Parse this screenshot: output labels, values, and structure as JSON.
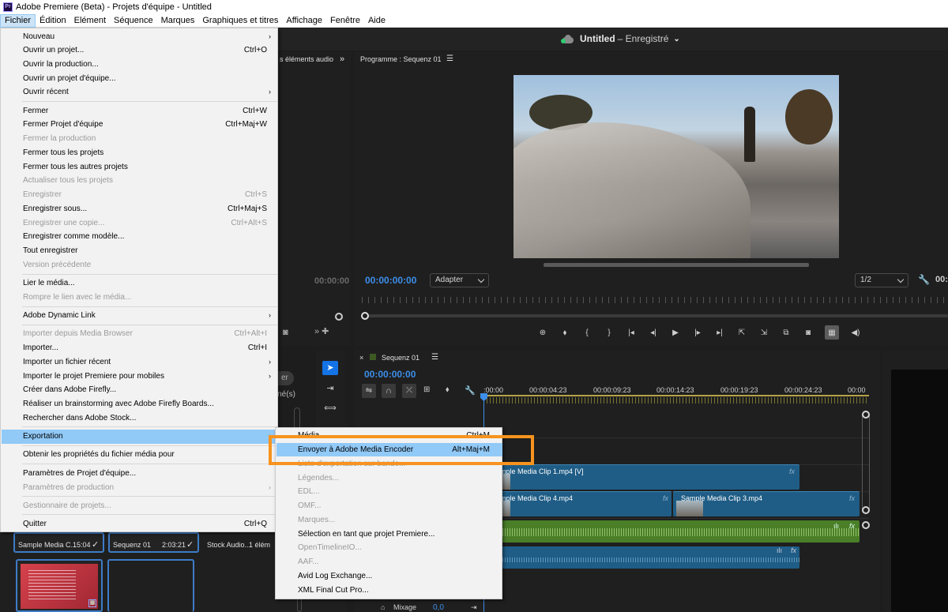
{
  "window": {
    "app_logo_text": "Pr",
    "title": "Adobe Premiere (Beta) - Projets d'équipe - Untitled"
  },
  "menubar": [
    "Fichier",
    "Édition",
    "Elément",
    "Séquence",
    "Marques",
    "Graphiques et titres",
    "Affichage",
    "Fenêtre",
    "Aide"
  ],
  "header": {
    "project_name": "Untitled",
    "status": "– Enregistré"
  },
  "program_monitor": {
    "title": "Programme : Sequenz 01",
    "timecode": "00:00:00:00",
    "fit": "Adapter",
    "resolution": "1/2",
    "right_timecode": "00:"
  },
  "left_panel": {
    "tab": "s éléments audio",
    "timecode": "00:00:00",
    "partial_button": "er",
    "partial_label": "onné(s)"
  },
  "timeline": {
    "title": "Sequenz 01",
    "timecode": "00:00:00:00",
    "ruler_labels": [
      ":00:00",
      "00:00:04:23",
      "00:00:09:23",
      "00:00:14:23",
      "00:00:19:23",
      "00:00:24:23",
      "00:00"
    ],
    "clips": {
      "v2": "Sample Media Clip 1.mp4 [V]",
      "v1a": "Sample Media Clip 4.mp4",
      "v1b": "Sample Media Clip 3.mp4"
    },
    "mixage_label": "Mixage",
    "mixage_value": "0,0"
  },
  "project_panel": {
    "items": [
      {
        "name": "Sample Media C...",
        "duration": "15:04"
      },
      {
        "name": "Sequenz 01",
        "duration": "2:03:21"
      },
      {
        "name": "Stock Audio...",
        "duration": "1 élém"
      }
    ]
  },
  "file_menu": [
    {
      "label": "Nouveau",
      "shortcut": "",
      "submenu": true,
      "enabled": true
    },
    {
      "label": "Ouvrir un projet...",
      "shortcut": "Ctrl+O",
      "enabled": true
    },
    {
      "label": "Ouvrir la production...",
      "shortcut": "",
      "enabled": true
    },
    {
      "label": "Ouvrir un projet d'équipe...",
      "shortcut": "",
      "enabled": true
    },
    {
      "label": "Ouvrir récent",
      "shortcut": "",
      "submenu": true,
      "enabled": true
    },
    {
      "label": "Fermer",
      "shortcut": "Ctrl+W",
      "enabled": true
    },
    {
      "label": "Fermer Projet d'équipe",
      "shortcut": "Ctrl+Maj+W",
      "enabled": true
    },
    {
      "label": "Fermer la production",
      "shortcut": "",
      "enabled": false
    },
    {
      "label": "Fermer tous les projets",
      "shortcut": "",
      "enabled": true
    },
    {
      "label": "Fermer tous les autres projets",
      "shortcut": "",
      "enabled": true
    },
    {
      "label": "Actualiser tous les projets",
      "shortcut": "",
      "enabled": false
    },
    {
      "label": "Enregistrer",
      "shortcut": "Ctrl+S",
      "enabled": false
    },
    {
      "label": "Enregistrer sous...",
      "shortcut": "Ctrl+Maj+S",
      "enabled": true
    },
    {
      "label": "Enregistrer une copie...",
      "shortcut": "Ctrl+Alt+S",
      "enabled": false
    },
    {
      "label": "Enregistrer comme modèle...",
      "shortcut": "",
      "enabled": true
    },
    {
      "label": "Tout enregistrer",
      "shortcut": "",
      "enabled": true
    },
    {
      "label": "Version précédente",
      "shortcut": "",
      "enabled": false
    },
    {
      "label": "Lier le média...",
      "shortcut": "",
      "enabled": true
    },
    {
      "label": "Rompre le lien avec le média...",
      "shortcut": "",
      "enabled": false
    },
    {
      "label": "Adobe Dynamic Link",
      "shortcut": "",
      "submenu": true,
      "enabled": true
    },
    {
      "label": "Importer depuis Media Browser",
      "shortcut": "Ctrl+Alt+I",
      "enabled": false
    },
    {
      "label": "Importer...",
      "shortcut": "Ctrl+I",
      "enabled": true
    },
    {
      "label": "Importer un fichier récent",
      "shortcut": "",
      "submenu": true,
      "enabled": true
    },
    {
      "label": "Importer le projet Premiere pour mobiles",
      "shortcut": "",
      "submenu": true,
      "enabled": true
    },
    {
      "label": "Créer dans Adobe Firefly...",
      "shortcut": "",
      "enabled": true
    },
    {
      "label": "Réaliser un brainstorming avec Adobe Firefly Boards...",
      "shortcut": "",
      "enabled": true
    },
    {
      "label": "Rechercher dans Adobe Stock...",
      "shortcut": "",
      "enabled": true
    },
    {
      "label": "Exportation",
      "shortcut": "",
      "submenu": true,
      "enabled": true,
      "highlighted": true
    },
    {
      "label": "Obtenir les propriétés du fichier média pour",
      "shortcut": "",
      "submenu": true,
      "enabled": true
    },
    {
      "label": "Paramètres de Projet d'équipe...",
      "shortcut": "",
      "enabled": true
    },
    {
      "label": "Paramètres de production",
      "shortcut": "",
      "submenu": true,
      "enabled": false
    },
    {
      "label": "Gestionnaire de projets...",
      "shortcut": "",
      "enabled": false
    },
    {
      "label": "Quitter",
      "shortcut": "Ctrl+Q",
      "enabled": true
    }
  ],
  "export_menu": [
    {
      "label": "Média...",
      "shortcut": "Ctrl+M",
      "enabled": true
    },
    {
      "label": "Envoyer à Adobe Media Encoder",
      "shortcut": "Alt+Maj+M",
      "enabled": true,
      "highlighted": true
    },
    {
      "label": "Liste d'exportation sur bande...",
      "shortcut": "",
      "enabled": false
    },
    {
      "label": "Légendes...",
      "shortcut": "",
      "enabled": false
    },
    {
      "label": "EDL...",
      "shortcut": "",
      "enabled": false
    },
    {
      "label": "OMF...",
      "shortcut": "",
      "enabled": false
    },
    {
      "label": "Marques...",
      "shortcut": "",
      "enabled": false
    },
    {
      "label": "Sélection en tant que projet Premiere...",
      "shortcut": "",
      "enabled": true
    },
    {
      "label": "OpenTimelineIO...",
      "shortcut": "",
      "enabled": false
    },
    {
      "label": "AAF...",
      "shortcut": "",
      "enabled": false
    },
    {
      "label": "Avid Log Exchange...",
      "shortcut": "",
      "enabled": true
    },
    {
      "label": "XML Final Cut Pro...",
      "shortcut": "",
      "enabled": true
    }
  ],
  "colors": {
    "accent_blue": "#3d8ee9",
    "menu_highlight": "#91c9f7",
    "callout_orange": "#f7931e",
    "video_clip": "#1f5d86",
    "audio_clip": "#4a7f28"
  }
}
